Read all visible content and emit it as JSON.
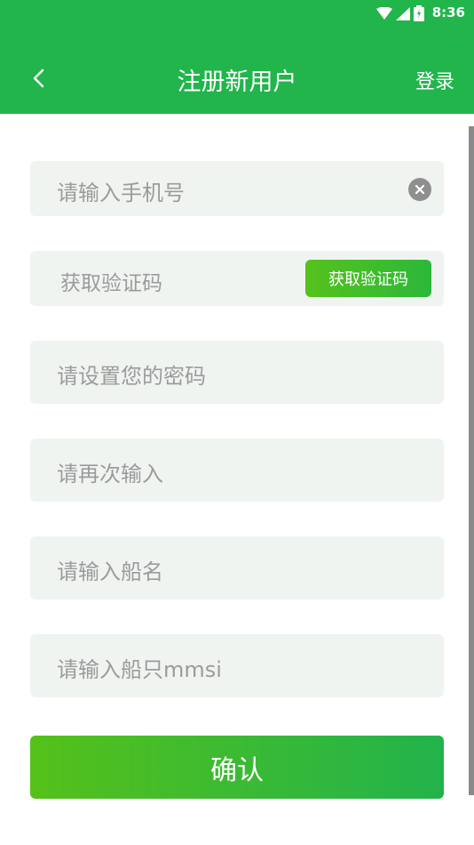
{
  "status_bar": {
    "time": "8:36"
  },
  "header": {
    "title": "注册新用户",
    "login_label": "登录"
  },
  "form": {
    "phone_placeholder": "请输入手机号",
    "code_placeholder": "获取验证码",
    "code_button": "获取验证码",
    "password_placeholder": "请设置您的密码",
    "confirm_password_placeholder": "请再次输入",
    "ship_name_placeholder": "请输入船名",
    "mmsi_placeholder": "请输入船只mmsi",
    "confirm_label": "确认"
  },
  "colors": {
    "primary": "#21b54b",
    "field_bg": "#f0f4f1",
    "placeholder": "#9b9b9b"
  }
}
